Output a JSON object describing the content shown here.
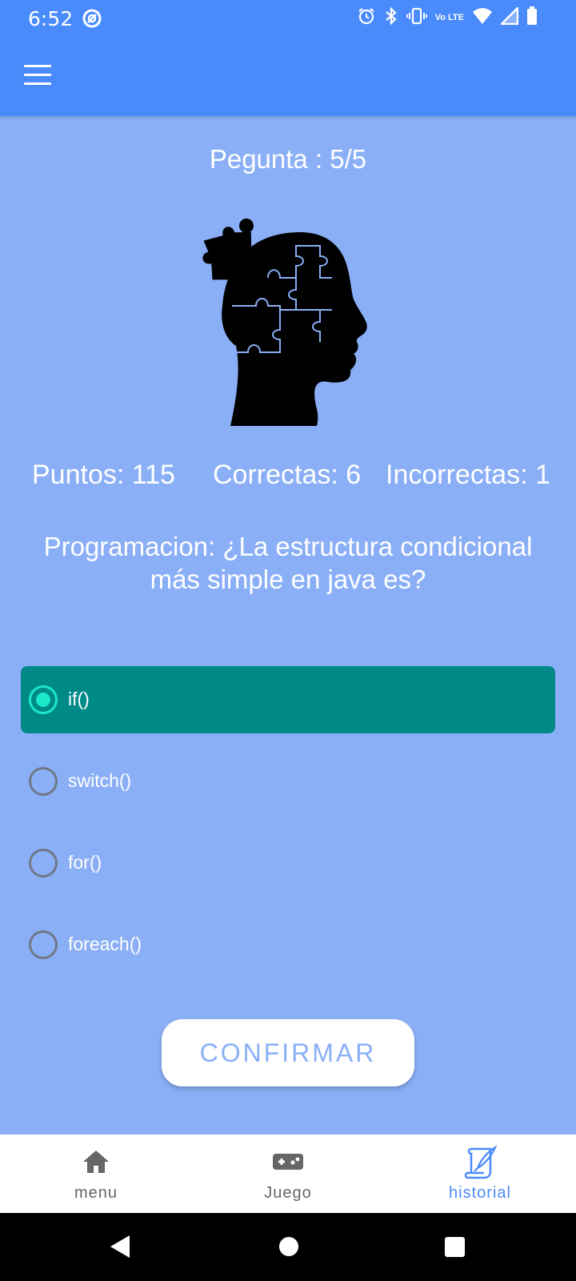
{
  "status_bar": {
    "time": "6:52",
    "network_label": "Vo LTE"
  },
  "quiz": {
    "question_count": "Pegunta : 5/5",
    "stats": {
      "puntos": "Puntos: 115",
      "correctas": "Correctas: 6",
      "incorrectas": "Incorrectas: 1"
    },
    "question_text": "Programacion: ¿La estructura condicional más simple en java es?",
    "options": [
      {
        "label": "if()",
        "selected": true
      },
      {
        "label": "switch()",
        "selected": false
      },
      {
        "label": "for()",
        "selected": false
      },
      {
        "label": "foreach()",
        "selected": false
      }
    ],
    "confirm_label": "CONFIRMAR"
  },
  "bottom_nav": {
    "items": [
      {
        "label": "menu",
        "icon": "home-icon",
        "active": false
      },
      {
        "label": "Juego",
        "icon": "gamepad-icon",
        "active": false
      },
      {
        "label": "historial",
        "icon": "scroll-quill-icon",
        "active": true
      }
    ]
  },
  "colors": {
    "primary": "#4A8BFC",
    "background": "#8AAFF6",
    "selected_option": "#008A87",
    "radio_accent": "#1BE8C8"
  }
}
